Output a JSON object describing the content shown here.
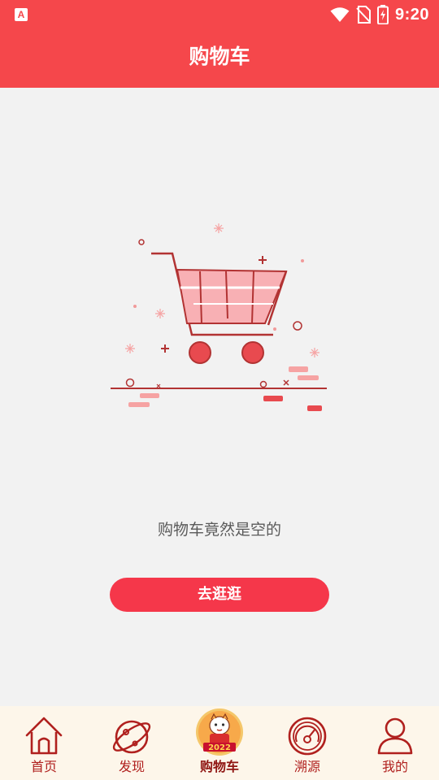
{
  "status_bar": {
    "app_icon_letter": "A",
    "time": "9:20",
    "icons": [
      "wifi-icon",
      "no-sim-icon",
      "battery-charging-icon"
    ]
  },
  "header": {
    "title": "购物车"
  },
  "empty_state": {
    "illustration": "empty-cart-illustration",
    "message": "购物车竟然是空的",
    "button_label": "去逛逛"
  },
  "bottom_nav": {
    "items": [
      {
        "label": "首页",
        "icon": "home-icon",
        "active": false
      },
      {
        "label": "发现",
        "icon": "planet-icon",
        "active": false
      },
      {
        "label": "购物车",
        "icon": "tiger-2022-badge-icon",
        "active": true
      },
      {
        "label": "溯源",
        "icon": "radar-icon",
        "active": false
      },
      {
        "label": "我的",
        "icon": "user-icon",
        "active": false
      }
    ]
  },
  "colors": {
    "primary_red": "#f5474b",
    "button_red": "#f5374a",
    "nav_background": "#fdf6ea",
    "nav_text": "#b0201e",
    "page_background": "#f2f2f2"
  }
}
